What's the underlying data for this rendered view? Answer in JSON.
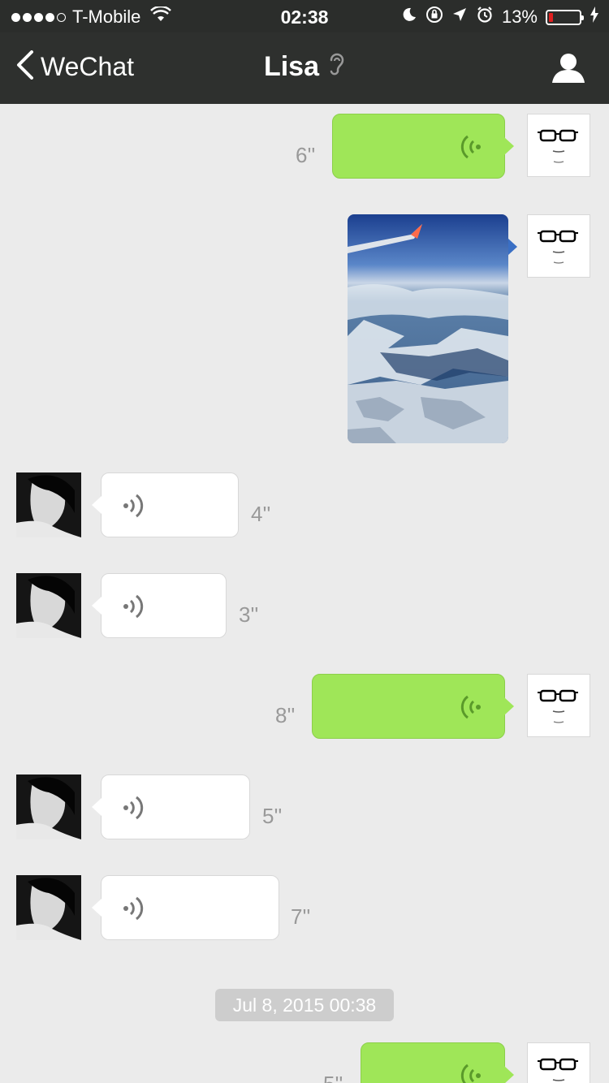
{
  "status_bar": {
    "carrier": "T-Mobile",
    "time": "02:38",
    "battery_percent": "13%",
    "battery_level": 0.13,
    "signal_bars": 4,
    "icons": [
      "wifi-icon",
      "moon-icon",
      "rotation-lock-icon",
      "location-arrow-icon",
      "alarm-icon",
      "charging-bolt-icon"
    ]
  },
  "nav": {
    "back_label": "WeChat",
    "title": "Lisa",
    "icons": [
      "chevron-left-icon",
      "ear-icon",
      "profile-icon"
    ]
  },
  "messages": [
    {
      "side": "right",
      "type": "voice",
      "duration": "6''"
    },
    {
      "side": "right",
      "type": "image",
      "description": "aerial-photo"
    },
    {
      "side": "left",
      "type": "voice",
      "duration": "4''"
    },
    {
      "side": "left",
      "type": "voice",
      "duration": "3''"
    },
    {
      "side": "right",
      "type": "voice",
      "duration": "8''"
    },
    {
      "side": "left",
      "type": "voice",
      "duration": "5''"
    },
    {
      "side": "left",
      "type": "voice",
      "duration": "7''"
    },
    {
      "side": "right",
      "type": "voice",
      "duration": "5''"
    }
  ],
  "timestamp": "Jul 8, 2015 00:38",
  "colors": {
    "nav_bg": "#2e302e",
    "chat_bg": "#ebebeb",
    "sent_bubble": "#9fe658",
    "received_bubble": "#ffffff",
    "battery_low": "#e02020"
  }
}
